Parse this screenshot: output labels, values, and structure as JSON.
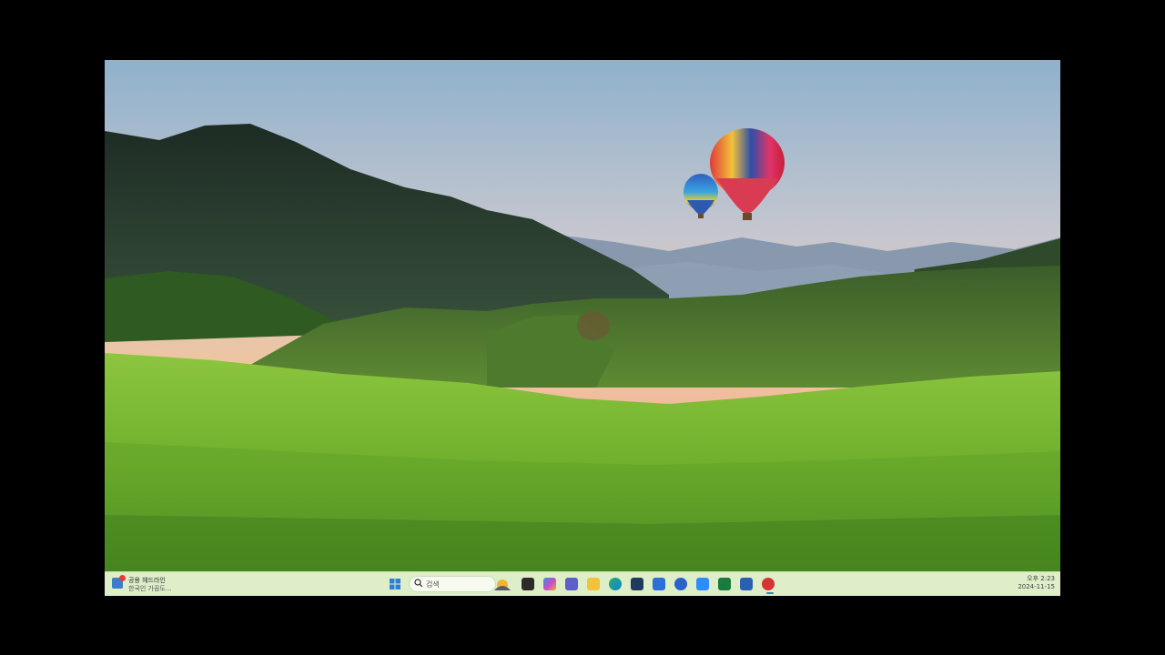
{
  "desktop": {
    "wallpaper": "green-tea-field-hot-air-balloons-sunset"
  },
  "taskbar": {
    "widget": {
      "line1": "공용 헤드라인",
      "line2": "한국인 가끔도...",
      "icon": "weather-news-icon"
    },
    "search": {
      "placeholder": "검색",
      "icon": "search-icon"
    },
    "apps": [
      "start-icon",
      "search-icon",
      "weather-icon",
      "task-view-icon",
      "copilot-icon",
      "teams-icon",
      "file-explorer-icon",
      "edge-icon",
      "store-icon",
      "app-blue-icon",
      "messenger-icon",
      "zoom-icon",
      "excel-icon",
      "word-icon",
      "red-app-icon"
    ],
    "clock": {
      "time": "오후 2:23",
      "date": "2024-11-15"
    }
  },
  "colors": {
    "taskbar_bg": "#ddeec8",
    "accent": "#3a7dc9"
  }
}
